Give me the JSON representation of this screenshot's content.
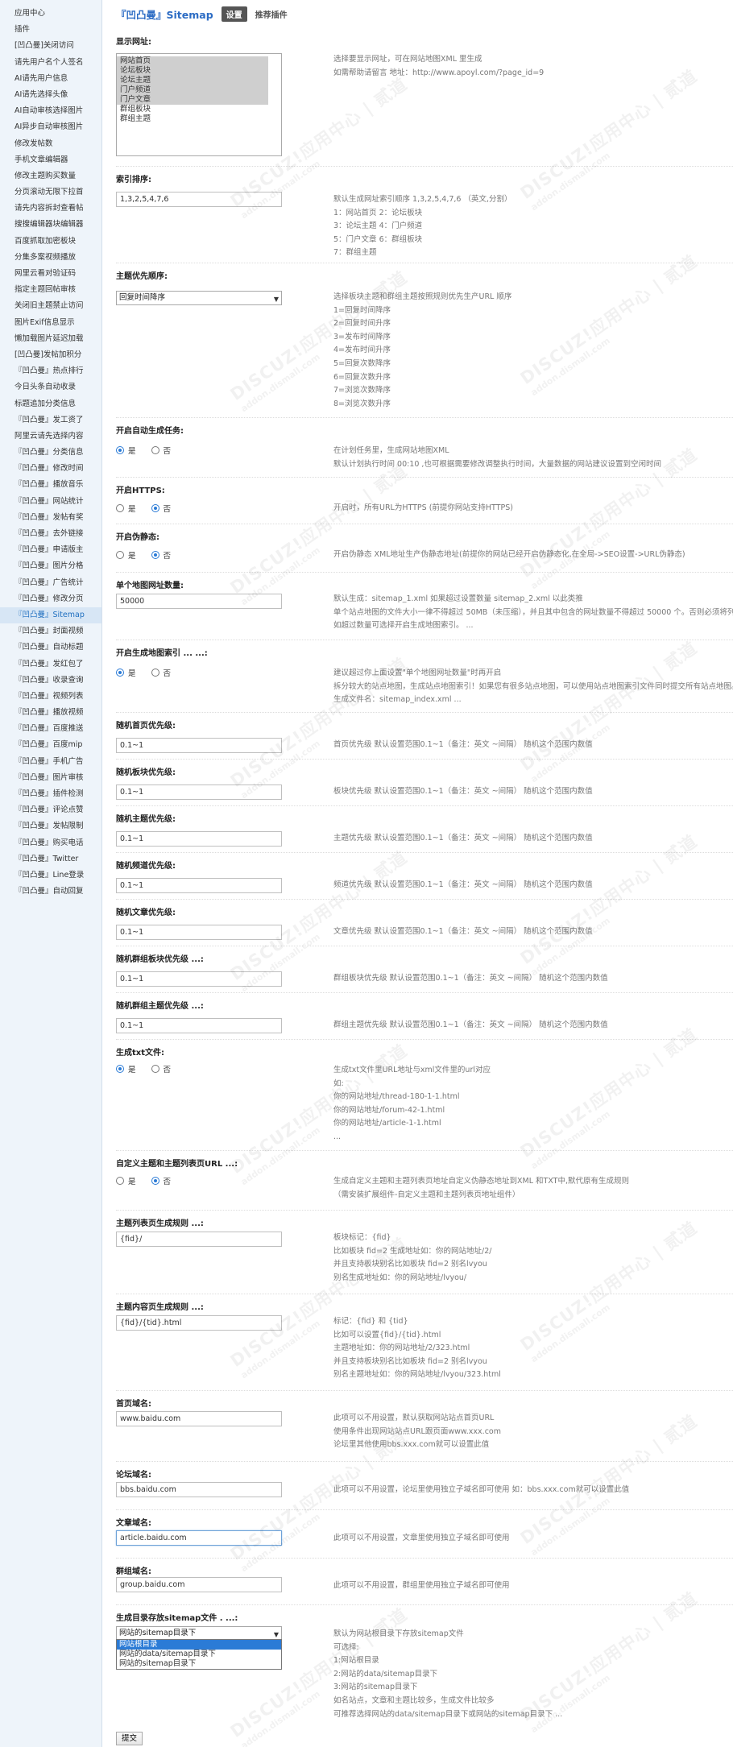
{
  "sidebar": {
    "items": [
      "应用中心",
      "插件",
      "[凹凸曼]关闭访问",
      "请先用户名个人签名",
      "AI请先用户信息",
      "AI请先选择头像",
      "AI自动审核选择图片",
      "AI异步自动审核图片",
      "修改发帖数",
      "手机文章编辑器",
      "修改主题购买数量",
      "分页滚动无限下拉首",
      "请先内容拆封查看帖",
      "搜搜编辑器块编辑器",
      "百度抓取加密板块",
      "分集多案视频播放",
      "网里云看对验证码",
      "指定主题回帖审核",
      "关闭旧主题禁止访问",
      "图片Exif信息显示",
      "懒加载图片延迟加载",
      "[凹凸曼]发帖加积分",
      "『凹凸曼』热点排行",
      "今日头条自动收录",
      "标题追加分类信息",
      "『凹凸曼』发工资了",
      "阿里云请先选择内容",
      "『凹凸曼』分类信息",
      "『凹凸曼』修改时间",
      "『凹凸曼』播放音乐",
      "『凹凸曼』网站统计",
      "『凹凸曼』发帖有奖",
      "『凹凸曼』去外链接",
      "『凹凸曼』申请版主",
      "『凹凸曼』图片分格",
      "『凹凸曼』广告统计",
      "『凹凸曼』修改分页",
      "『凹凸曼』Sitemap",
      "『凹凸曼』封面视频",
      "『凹凸曼』自动标题",
      "『凹凸曼』发红包了",
      "『凹凸曼』收录查询",
      "『凹凸曼』视频列表",
      "『凹凸曼』播放视频",
      "『凹凸曼』百度推送",
      "『凹凸曼』百度mip",
      "『凹凸曼』手机广告",
      "『凹凸曼』图片审核",
      "『凹凸曼』插件检测",
      "『凹凸曼』评论点赞",
      "『凹凸曼』发帖限制",
      "『凹凸曼』购买电话",
      "『凹凸曼』Twitter",
      "『凹凸曼』Line登录",
      "『凹凸曼』自动回复"
    ],
    "active_label": "『凹凸曼』Sitemap"
  },
  "header": {
    "title": "『凹凸曼』Sitemap",
    "tab_settings": "设置",
    "tab_recommend": "推荐插件"
  },
  "display_site": {
    "title": "显示网址:",
    "options": [
      "网站首页",
      "论坛板块",
      "论坛主题",
      "门户频道",
      "门户文章",
      "群组板块",
      "群组主题"
    ],
    "selected": [
      true,
      true,
      true,
      true,
      true,
      false,
      false
    ],
    "desc": [
      "选择要显示网址，可在网站地图XML 里生成",
      "如需帮助请留言 地址：http://www.apoyl.com/?page_id=9"
    ]
  },
  "index_order": {
    "title": "索引排序:",
    "value": "1,3,2,5,4,7,6",
    "desc": [
      "默认生成网址索引顺序 1,3,2,5,4,7,6 （英文,分割）",
      "1：网站首页 2：论坛板块",
      "3：论坛主题 4：门户频道",
      "5：门户文章 6：群组板块",
      "7：群组主题"
    ]
  },
  "thread_priority": {
    "title": "主题优先顺序:",
    "value": "回复时间降序",
    "desc": [
      "选择板块主题和群组主题按照规则优先生产URL 顺序",
      "1=回复时间降序",
      "2=回复时间升序",
      "3=发布时间降序",
      "4=发布时间升序",
      "5=回复次数降序",
      "6=回复次数升序",
      "7=浏览次数降序",
      "8=浏览次数升序"
    ]
  },
  "auto_task": {
    "title": "开启自动生成任务:",
    "yes": "是",
    "no": "否",
    "selected": "yes",
    "desc": [
      "在计划任务里，生成网站地图XML",
      "默认计划执行时间 00:10 ,也可根据需要修改调整执行时间，大量数据的网站建议设置到空闲时间"
    ]
  },
  "https": {
    "title": "开启HTTPS:",
    "yes": "是",
    "no": "否",
    "selected": "no",
    "desc": [
      "开启时，所有URL为HTTPS (前提你网站支持HTTPS)"
    ]
  },
  "pseudo_static": {
    "title": "开启伪静态:",
    "yes": "是",
    "no": "否",
    "selected": "no",
    "desc": [
      "开启伪静态 XML地址生产伪静态地址(前提你的网站已经开启伪静态化,在全局->SEO设置->URL伪静态)"
    ]
  },
  "max_urls": {
    "title": "单个地图网址数量:",
    "value": "50000",
    "desc": [
      "默认生成：sitemap_1.xml 如果超过设置数量 sitemap_2.xml 以此类推",
      "单个站点地图的文件大小一律不得超过 50MB（未压缩），并且其中包含的网址数量不得超过 50000 个。否则必须将列表分成多个站点地图。",
      "如超过数量可选择开启生成地图索引。 ..."
    ]
  },
  "sitemap_index": {
    "title": "开启生成地图索引 ... ...:",
    "yes": "是",
    "no": "否",
    "selected": "yes",
    "desc": [
      "建议超过你上面设置\"单个地图网址数量\"时再开启",
      "拆分较大的站点地图，生成站点地图索引！如果您有很多站点地图，可以使用站点地图索引文件同时提交所有站点地图。",
      "生成文件名：sitemap_index.xml ..."
    ]
  },
  "priorities": [
    {
      "title": "随机首页优先级:",
      "value": "0.1~1",
      "desc": "首页优先级 默认设置范围0.1~1（备注：英文 ~间隔） 随机这个范围内数值"
    },
    {
      "title": "随机板块优先级:",
      "value": "0.1~1",
      "desc": "板块优先级 默认设置范围0.1~1（备注：英文 ~间隔） 随机这个范围内数值"
    },
    {
      "title": "随机主题优先级:",
      "value": "0.1~1",
      "desc": "主题优先级 默认设置范围0.1~1（备注：英文 ~间隔） 随机这个范围内数值"
    },
    {
      "title": "随机频道优先级:",
      "value": "0.1~1",
      "desc": "频道优先级 默认设置范围0.1~1（备注：英文 ~间隔） 随机这个范围内数值"
    },
    {
      "title": "随机文章优先级:",
      "value": "0.1~1",
      "desc": "文章优先级 默认设置范围0.1~1（备注：英文 ~间隔） 随机这个范围内数值"
    },
    {
      "title": "随机群组板块优先级 ...:",
      "value": "0.1~1",
      "desc": "群组板块优先级 默认设置范围0.1~1（备注：英文 ~间隔） 随机这个范围内数值"
    },
    {
      "title": "随机群组主题优先级 ...:",
      "value": "0.1~1",
      "desc": "群组主题优先级 默认设置范围0.1~1（备注：英文 ~间隔） 随机这个范围内数值"
    }
  ],
  "gen_txt": {
    "title": "生成txt文件:",
    "yes": "是",
    "no": "否",
    "selected": "yes",
    "desc": [
      "生成txt文件里URL地址与xml文件里的url对应",
      "如:",
      "你的网站地址/thread-180-1-1.html",
      "你的网站地址/forum-42-1.html",
      "你的网站地址/article-1-1.html",
      "..."
    ]
  },
  "custom_url": {
    "title": "自定义主题和主题列表页URL ...:",
    "yes": "是",
    "no": "否",
    "selected": "no",
    "desc": [
      "生成自定义主题和主题列表页地址自定义伪静态地址到XML 和TXT中,默代原有生成规则",
      "（需安装扩展组件-自定义主题和主题列表页地址组件）"
    ]
  },
  "list_rule": {
    "title": "主题列表页生成规则 ...:",
    "value": "{fid}/",
    "desc": [
      "板块标记：{fid}",
      "比如板块 fid=2 生成地址如：你的网站地址/2/",
      "并且支持板块别名比如板块 fid=2 别名lvyou",
      "别名生成地址如：你的网站地址/lvyou/"
    ]
  },
  "content_rule": {
    "title": "主题内容页生成规则 ...:",
    "value": "{fid}/{tid}.html",
    "desc": [
      "标记：{fid} 和 {tid}",
      "比如可以设置{fid}/{tid}.html",
      "主题地址如：你的网站地址/2/323.html",
      "并且支持板块别名比如板块 fid=2 别名lvyou",
      "别名主题地址如：你的网站地址/lvyou/323.html"
    ]
  },
  "home_domain": {
    "title": "首页域名:",
    "value": "www.baidu.com",
    "desc": [
      "此项可以不用设置，默认获取网站站点首页URL",
      "使用条件出现网站站点URL跟页面www.xxx.com",
      "论坛里其他使用bbs.xxx.com就可以设置此值"
    ]
  },
  "forum_domain": {
    "title": "论坛域名:",
    "value": "bbs.baidu.com",
    "desc": [
      "此项可以不用设置，论坛里使用独立子域名即可使用 如：bbs.xxx.com就可以设置此值"
    ]
  },
  "article_domain": {
    "title": "文章域名:",
    "value": "article.baidu.com",
    "desc": [
      "此项可以不用设置，文章里使用独立子域名即可使用"
    ]
  },
  "group_domain": {
    "title": "群组域名:",
    "value": "group.baidu.com",
    "desc": [
      "此项可以不用设置，群组里使用独立子域名即可使用"
    ]
  },
  "gen_dir": {
    "title": "生成目录存放sitemap文件 . ...:",
    "value": "网站的sitemap目录下",
    "options": [
      "网站根目录",
      "网站的data/sitemap目录下",
      "网站的sitemap目录下"
    ],
    "highlighted": 0,
    "desc": [
      "默认为网站根目录下存放sitemap文件",
      "可选择:",
      "1:网站根目录",
      "2:网站的data/sitemap目录下",
      "3:网站的sitemap目录下",
      "如名站点，文章和主题比较多，生成文件比较多",
      "可推荐选择网站的data/sitemap目录下或网站的sitemap目录下 ..."
    ]
  },
  "submit_label": "提交",
  "watermark": {
    "brand": "DISCUZ!应用中心 | 贰道",
    "url": "addon.dismall.com"
  },
  "colors": {
    "accent": "#2b7bd6",
    "title_blue": "#2c6cc4",
    "sidebar_bg": "#eef4fa"
  }
}
